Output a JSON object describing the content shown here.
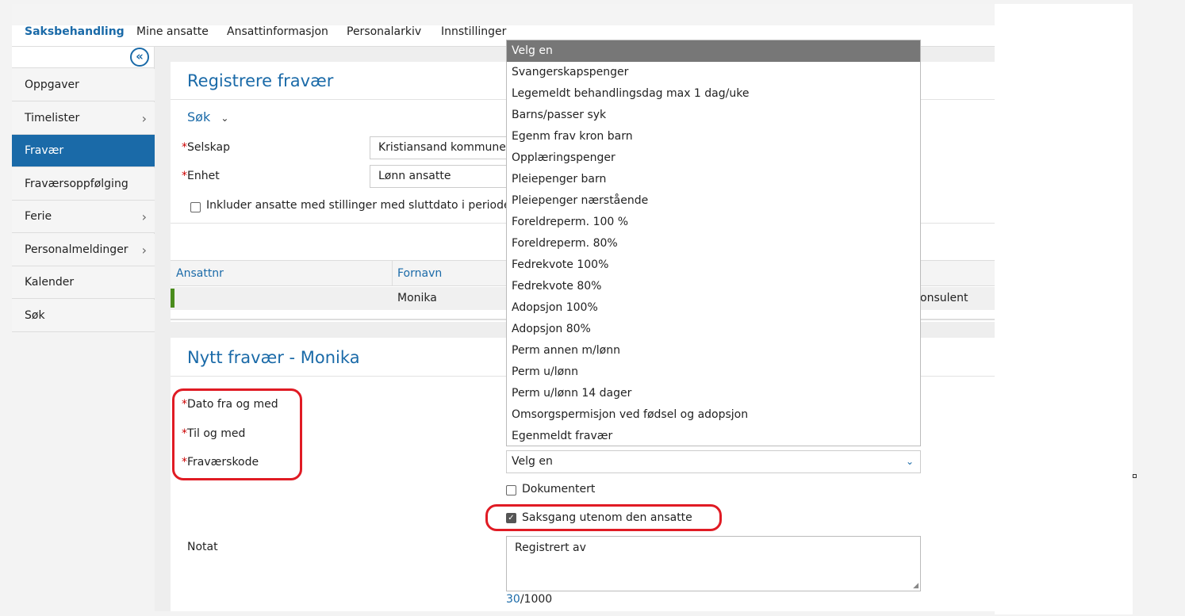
{
  "topnav": {
    "items": [
      "Saksbehandling",
      "Mine ansatte",
      "Ansattinformasjon",
      "Personalarkiv",
      "Innstillinger"
    ]
  },
  "sidebar": {
    "collapse_icon": "double-chevron-left-icon",
    "items": [
      {
        "label": "Oppgaver",
        "chevron": false
      },
      {
        "label": "Timelister",
        "chevron": true
      },
      {
        "label": "Fravær",
        "chevron": false
      },
      {
        "label": "Fraværsoppfølging",
        "chevron": false
      },
      {
        "label": "Ferie",
        "chevron": true
      },
      {
        "label": "Personalmeldinger",
        "chevron": true
      },
      {
        "label": "Kalender",
        "chevron": false
      },
      {
        "label": "Søk",
        "chevron": false
      }
    ]
  },
  "register": {
    "title": "Registrere fravær",
    "search_toggle": "Søk",
    "selskap_label": "Selskap",
    "selskap_value": "Kristiansand kommune",
    "enhet_label": "Enhet",
    "enhet_value": "Lønn ansatte",
    "include_label": "Inkluder ansatte med stillinger med sluttdato i perioden"
  },
  "table": {
    "headers": [
      "Ansattnr",
      "Fornavn"
    ],
    "row": {
      "fornavn": "Monika",
      "tail": "onsulent"
    }
  },
  "new_absence": {
    "title": "Nytt fravær - Monika",
    "dato_fra_label": "Dato fra og med",
    "til_label": "Til og med",
    "kode_label": "Fraværskode",
    "kode_select_value": "Velg en",
    "dokumentert_label": "Dokumentert",
    "saksgang_label": "Saksgang utenom den ansatte",
    "notat_label": "Notat",
    "notat_value": "Registrert av",
    "char_count": "30",
    "char_max": "/1000"
  },
  "dropdown": {
    "options": [
      "Velg en",
      "Svangerskapspenger",
      "Legemeldt behandlingsdag max 1 dag/uke",
      "Barns/passer syk",
      "Egenm frav kron barn",
      "Opplæringspenger",
      "Pleiepenger barn",
      "Pleiepenger nærstående",
      "Foreldreperm. 100 %",
      "Foreldreperm. 80%",
      "Fedrekvote 100%",
      "Fedrekvote 80%",
      "Adopsjon 100%",
      "Adopsjon 80%",
      "Perm annen m/lønn",
      "Perm u/lønn",
      "Perm u/lønn 14 dager",
      "Omsorgspermisjon ved fødsel og adopsjon",
      "Egenmeldt fravær"
    ]
  },
  "colors": {
    "accent": "#1a6aa8",
    "selected_option": "#777777",
    "highlight": "#e01b24"
  }
}
